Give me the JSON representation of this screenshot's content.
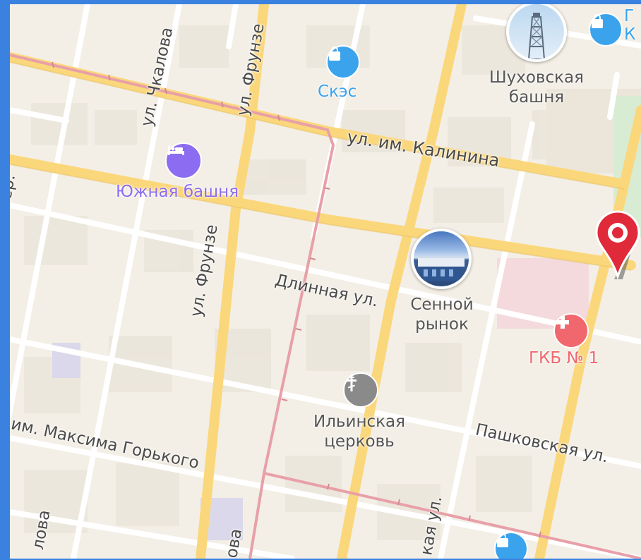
{
  "colors": {
    "frame": "#3b82e0",
    "background": "#f3efe6",
    "major_road": "#fbd77b",
    "minor_road": "#ffffff",
    "tram_line": "#e8a0a8",
    "hotel_poi": "#8c6cf0",
    "shop_poi": "#3ba3ec",
    "church_poi": "#8a8a8a",
    "hospital_poi": "#f0686e",
    "location_pin": "#e02a3a"
  },
  "streets": [
    {
      "id": "kalinina",
      "text": "ул. им. Калинина"
    },
    {
      "id": "chkalova",
      "text": "ул. Чкалова"
    },
    {
      "id": "frunze-top",
      "text": "ул. Фрунзе"
    },
    {
      "id": "frunze-mid",
      "text": "ул. Фрунзе"
    },
    {
      "id": "dlinnaya",
      "text": "Длинная ул."
    },
    {
      "id": "gorkogo",
      "text": "им. Максима Горького"
    },
    {
      "id": "pashkovskaya",
      "text": "Пашковская ул."
    },
    {
      "id": "bottom-left",
      "text": "лова"
    },
    {
      "id": "bottom-mid",
      "text": "ова"
    },
    {
      "id": "bottom-right",
      "text": "кая ул."
    },
    {
      "id": "left-edge",
      "text": "ер."
    }
  ],
  "pois": {
    "skes": {
      "label": "Скэс",
      "icon": "shopping-bag-icon"
    },
    "top_right_shop": {
      "label": "Г\nК",
      "icon": "shopping-bag-icon"
    },
    "shukhov_tower": {
      "label": "Шуховская\nбашня",
      "icon": "tower-photo"
    },
    "south_tower": {
      "label": "Южная башня",
      "icon": "bed-icon"
    },
    "senny_market": {
      "label": "Сенной\nрынок",
      "icon": "market-photo"
    },
    "gkb1": {
      "label": "ГКБ № 1",
      "icon": "medical-cross-icon"
    },
    "ilinskaya_church": {
      "label": "Ильинская\nцерковь",
      "icon": "orthodox-cross-icon"
    },
    "bottom_shop": {
      "label": "",
      "icon": "shopping-bag-icon"
    }
  },
  "selected_marker": {
    "icon": "location-pin-icon"
  }
}
